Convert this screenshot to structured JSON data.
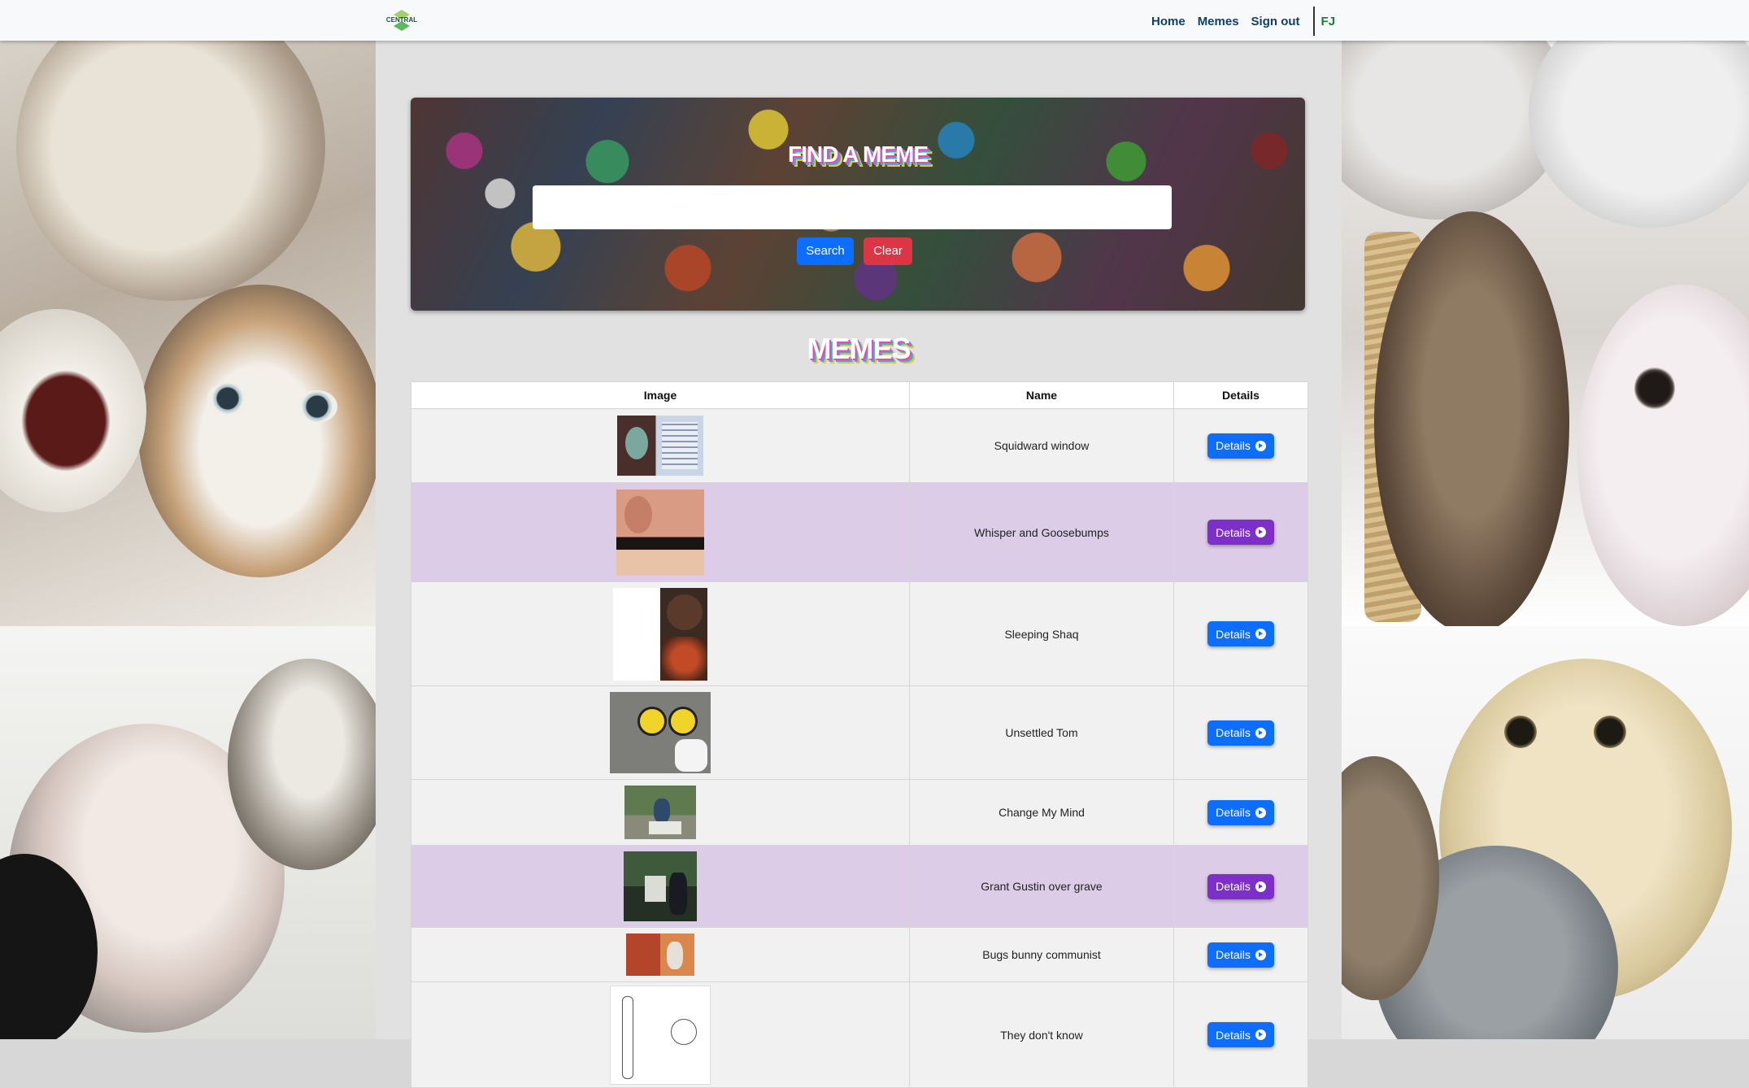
{
  "navbar": {
    "logo_text": "CENTRAL",
    "links": [
      "Home",
      "Memes",
      "Sign out"
    ],
    "user": "FJ"
  },
  "hero": {
    "title": "FIND A MEME",
    "search_value": "",
    "search_label": "Search",
    "clear_label": "Clear"
  },
  "memes_title": "MEMES",
  "table": {
    "headers": [
      "Image",
      "Name",
      "Details"
    ],
    "details_label": "Details",
    "rows": [
      {
        "name": "Squidward window",
        "thumb": "squidward-window-thumbnail",
        "highlight": false
      },
      {
        "name": "Whisper and Goosebumps",
        "thumb": "whisper-goosebumps-thumbnail",
        "highlight": true
      },
      {
        "name": "Sleeping Shaq",
        "thumb": "sleeping-shaq-thumbnail",
        "highlight": false
      },
      {
        "name": "Unsettled Tom",
        "thumb": "unsettled-tom-thumbnail",
        "highlight": false
      },
      {
        "name": "Change My Mind",
        "thumb": "change-my-mind-thumbnail",
        "highlight": false
      },
      {
        "name": "Grant Gustin over grave",
        "thumb": "grant-gustin-thumbnail",
        "highlight": true
      },
      {
        "name": "Bugs bunny communist",
        "thumb": "bugs-bunny-thumbnail",
        "highlight": false
      },
      {
        "name": "They don't know",
        "thumb": "they-dont-know-thumbnail",
        "highlight": false
      }
    ]
  },
  "colors": {
    "primary": "#0d6efd",
    "danger": "#dc3545",
    "highlight_row": "#dccce8",
    "purple_button": "#7e2ec9"
  }
}
